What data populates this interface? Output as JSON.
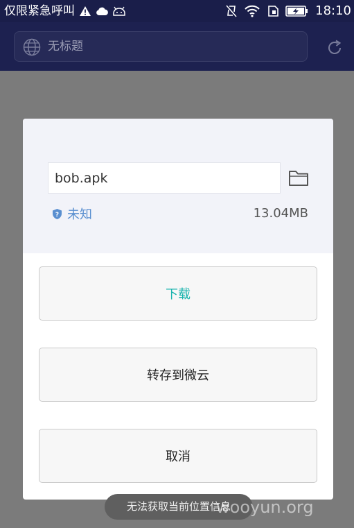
{
  "status_bar": {
    "carrier_text": "仅限紧急呼叫",
    "time": "18:10",
    "icons": [
      "warning-icon",
      "cloud-icon",
      "android-icon",
      "vibrate-off-icon",
      "wifi-icon",
      "sim-icon",
      "battery-charging-icon"
    ]
  },
  "address_bar": {
    "page_title": "无标题",
    "icons": [
      "globe-icon",
      "refresh-icon"
    ]
  },
  "download_dialog": {
    "filename": "bob.apk",
    "security_label": "未知",
    "file_size": "13.04MB",
    "download_label": "下载",
    "save_to_weiyun_label": "转存到微云",
    "cancel_label": "取消",
    "icons": [
      "folder-icon",
      "shield-icon"
    ]
  },
  "toast": {
    "message": "无法获取当前位置信息"
  },
  "watermark": {
    "text": "wooyun.org"
  },
  "colors": {
    "status_bar_bg": "#1a1e4a",
    "address_bar_bg": "#1d2150",
    "overlay_bg": "#7b7b7b",
    "dialog_header_bg": "#f2f3f9",
    "download_text": "#17b3ad",
    "security_text": "#5a8fd0"
  }
}
